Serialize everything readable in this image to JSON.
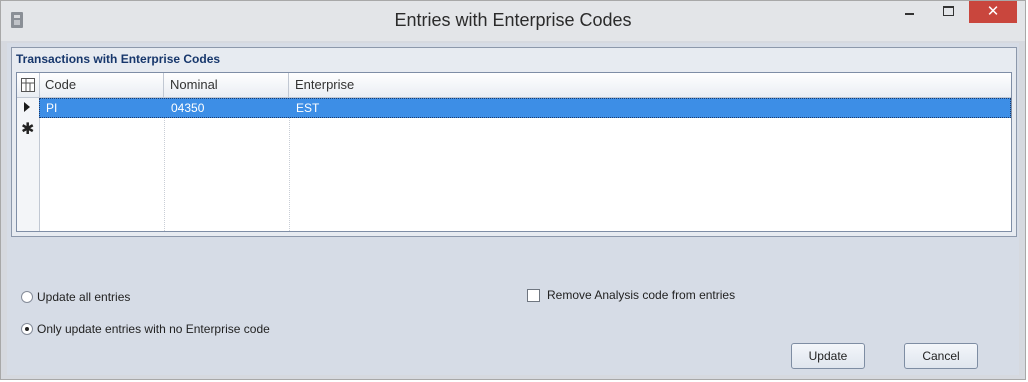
{
  "window": {
    "title": "Entries with Enterprise Codes",
    "close_glyph": "✕",
    "icons": {
      "app": "app-icon",
      "minimize": "minimize-icon",
      "maximize": "maximize-icon",
      "close": "close-icon"
    }
  },
  "group": {
    "caption": "Transactions with Enterprise Codes"
  },
  "grid": {
    "columns": [
      "Code",
      "Nominal",
      "Enterprise"
    ],
    "rows": [
      {
        "code": "PI",
        "nominal": "04350",
        "enterprise": "EST"
      }
    ],
    "new_row_glyph": "✱"
  },
  "options": {
    "update_all": "Update all entries",
    "only_update": "Only update entries with no Enterprise code",
    "selected": "only_update",
    "remove_analysis": "Remove Analysis code from entries",
    "remove_analysis_checked": false
  },
  "buttons": {
    "update": "Update",
    "cancel": "Cancel"
  },
  "colors": {
    "selection": "#3d8ee6",
    "close_button": "#c9463d",
    "caption_text": "#17376c"
  }
}
